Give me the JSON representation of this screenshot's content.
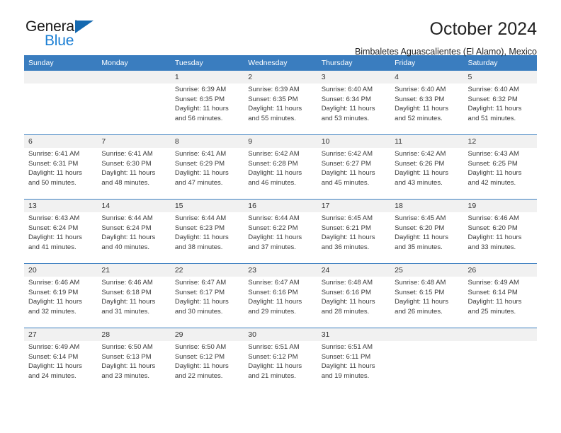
{
  "brand": {
    "name_part1": "General",
    "name_part2": "Blue",
    "triangle_color": "#1569b0",
    "blue_color": "#1b7fd4"
  },
  "header": {
    "title": "October 2024",
    "subtitle": "Bimbaletes Aguascalientes (El Alamo), Mexico"
  },
  "theme": {
    "header_bg": "#3a7dbf",
    "header_text": "#ffffff",
    "daynum_bg": "#f1f1f1",
    "body_bg": "#ffffff",
    "separator": "#3a7dbf"
  },
  "weekday_headers": [
    "Sunday",
    "Monday",
    "Tuesday",
    "Wednesday",
    "Thursday",
    "Friday",
    "Saturday"
  ],
  "weeks": [
    [
      {
        "day": "",
        "sunrise": "",
        "sunset": "",
        "daylight_line1": "",
        "daylight_line2": ""
      },
      {
        "day": "",
        "sunrise": "",
        "sunset": "",
        "daylight_line1": "",
        "daylight_line2": ""
      },
      {
        "day": "1",
        "sunrise": "Sunrise: 6:39 AM",
        "sunset": "Sunset: 6:35 PM",
        "daylight_line1": "Daylight: 11 hours",
        "daylight_line2": "and 56 minutes."
      },
      {
        "day": "2",
        "sunrise": "Sunrise: 6:39 AM",
        "sunset": "Sunset: 6:35 PM",
        "daylight_line1": "Daylight: 11 hours",
        "daylight_line2": "and 55 minutes."
      },
      {
        "day": "3",
        "sunrise": "Sunrise: 6:40 AM",
        "sunset": "Sunset: 6:34 PM",
        "daylight_line1": "Daylight: 11 hours",
        "daylight_line2": "and 53 minutes."
      },
      {
        "day": "4",
        "sunrise": "Sunrise: 6:40 AM",
        "sunset": "Sunset: 6:33 PM",
        "daylight_line1": "Daylight: 11 hours",
        "daylight_line2": "and 52 minutes."
      },
      {
        "day": "5",
        "sunrise": "Sunrise: 6:40 AM",
        "sunset": "Sunset: 6:32 PM",
        "daylight_line1": "Daylight: 11 hours",
        "daylight_line2": "and 51 minutes."
      }
    ],
    [
      {
        "day": "6",
        "sunrise": "Sunrise: 6:41 AM",
        "sunset": "Sunset: 6:31 PM",
        "daylight_line1": "Daylight: 11 hours",
        "daylight_line2": "and 50 minutes."
      },
      {
        "day": "7",
        "sunrise": "Sunrise: 6:41 AM",
        "sunset": "Sunset: 6:30 PM",
        "daylight_line1": "Daylight: 11 hours",
        "daylight_line2": "and 48 minutes."
      },
      {
        "day": "8",
        "sunrise": "Sunrise: 6:41 AM",
        "sunset": "Sunset: 6:29 PM",
        "daylight_line1": "Daylight: 11 hours",
        "daylight_line2": "and 47 minutes."
      },
      {
        "day": "9",
        "sunrise": "Sunrise: 6:42 AM",
        "sunset": "Sunset: 6:28 PM",
        "daylight_line1": "Daylight: 11 hours",
        "daylight_line2": "and 46 minutes."
      },
      {
        "day": "10",
        "sunrise": "Sunrise: 6:42 AM",
        "sunset": "Sunset: 6:27 PM",
        "daylight_line1": "Daylight: 11 hours",
        "daylight_line2": "and 45 minutes."
      },
      {
        "day": "11",
        "sunrise": "Sunrise: 6:42 AM",
        "sunset": "Sunset: 6:26 PM",
        "daylight_line1": "Daylight: 11 hours",
        "daylight_line2": "and 43 minutes."
      },
      {
        "day": "12",
        "sunrise": "Sunrise: 6:43 AM",
        "sunset": "Sunset: 6:25 PM",
        "daylight_line1": "Daylight: 11 hours",
        "daylight_line2": "and 42 minutes."
      }
    ],
    [
      {
        "day": "13",
        "sunrise": "Sunrise: 6:43 AM",
        "sunset": "Sunset: 6:24 PM",
        "daylight_line1": "Daylight: 11 hours",
        "daylight_line2": "and 41 minutes."
      },
      {
        "day": "14",
        "sunrise": "Sunrise: 6:44 AM",
        "sunset": "Sunset: 6:24 PM",
        "daylight_line1": "Daylight: 11 hours",
        "daylight_line2": "and 40 minutes."
      },
      {
        "day": "15",
        "sunrise": "Sunrise: 6:44 AM",
        "sunset": "Sunset: 6:23 PM",
        "daylight_line1": "Daylight: 11 hours",
        "daylight_line2": "and 38 minutes."
      },
      {
        "day": "16",
        "sunrise": "Sunrise: 6:44 AM",
        "sunset": "Sunset: 6:22 PM",
        "daylight_line1": "Daylight: 11 hours",
        "daylight_line2": "and 37 minutes."
      },
      {
        "day": "17",
        "sunrise": "Sunrise: 6:45 AM",
        "sunset": "Sunset: 6:21 PM",
        "daylight_line1": "Daylight: 11 hours",
        "daylight_line2": "and 36 minutes."
      },
      {
        "day": "18",
        "sunrise": "Sunrise: 6:45 AM",
        "sunset": "Sunset: 6:20 PM",
        "daylight_line1": "Daylight: 11 hours",
        "daylight_line2": "and 35 minutes."
      },
      {
        "day": "19",
        "sunrise": "Sunrise: 6:46 AM",
        "sunset": "Sunset: 6:20 PM",
        "daylight_line1": "Daylight: 11 hours",
        "daylight_line2": "and 33 minutes."
      }
    ],
    [
      {
        "day": "20",
        "sunrise": "Sunrise: 6:46 AM",
        "sunset": "Sunset: 6:19 PM",
        "daylight_line1": "Daylight: 11 hours",
        "daylight_line2": "and 32 minutes."
      },
      {
        "day": "21",
        "sunrise": "Sunrise: 6:46 AM",
        "sunset": "Sunset: 6:18 PM",
        "daylight_line1": "Daylight: 11 hours",
        "daylight_line2": "and 31 minutes."
      },
      {
        "day": "22",
        "sunrise": "Sunrise: 6:47 AM",
        "sunset": "Sunset: 6:17 PM",
        "daylight_line1": "Daylight: 11 hours",
        "daylight_line2": "and 30 minutes."
      },
      {
        "day": "23",
        "sunrise": "Sunrise: 6:47 AM",
        "sunset": "Sunset: 6:16 PM",
        "daylight_line1": "Daylight: 11 hours",
        "daylight_line2": "and 29 minutes."
      },
      {
        "day": "24",
        "sunrise": "Sunrise: 6:48 AM",
        "sunset": "Sunset: 6:16 PM",
        "daylight_line1": "Daylight: 11 hours",
        "daylight_line2": "and 28 minutes."
      },
      {
        "day": "25",
        "sunrise": "Sunrise: 6:48 AM",
        "sunset": "Sunset: 6:15 PM",
        "daylight_line1": "Daylight: 11 hours",
        "daylight_line2": "and 26 minutes."
      },
      {
        "day": "26",
        "sunrise": "Sunrise: 6:49 AM",
        "sunset": "Sunset: 6:14 PM",
        "daylight_line1": "Daylight: 11 hours",
        "daylight_line2": "and 25 minutes."
      }
    ],
    [
      {
        "day": "27",
        "sunrise": "Sunrise: 6:49 AM",
        "sunset": "Sunset: 6:14 PM",
        "daylight_line1": "Daylight: 11 hours",
        "daylight_line2": "and 24 minutes."
      },
      {
        "day": "28",
        "sunrise": "Sunrise: 6:50 AM",
        "sunset": "Sunset: 6:13 PM",
        "daylight_line1": "Daylight: 11 hours",
        "daylight_line2": "and 23 minutes."
      },
      {
        "day": "29",
        "sunrise": "Sunrise: 6:50 AM",
        "sunset": "Sunset: 6:12 PM",
        "daylight_line1": "Daylight: 11 hours",
        "daylight_line2": "and 22 minutes."
      },
      {
        "day": "30",
        "sunrise": "Sunrise: 6:51 AM",
        "sunset": "Sunset: 6:12 PM",
        "daylight_line1": "Daylight: 11 hours",
        "daylight_line2": "and 21 minutes."
      },
      {
        "day": "31",
        "sunrise": "Sunrise: 6:51 AM",
        "sunset": "Sunset: 6:11 PM",
        "daylight_line1": "Daylight: 11 hours",
        "daylight_line2": "and 19 minutes."
      },
      {
        "day": "",
        "sunrise": "",
        "sunset": "",
        "daylight_line1": "",
        "daylight_line2": ""
      },
      {
        "day": "",
        "sunrise": "",
        "sunset": "",
        "daylight_line1": "",
        "daylight_line2": ""
      }
    ]
  ]
}
